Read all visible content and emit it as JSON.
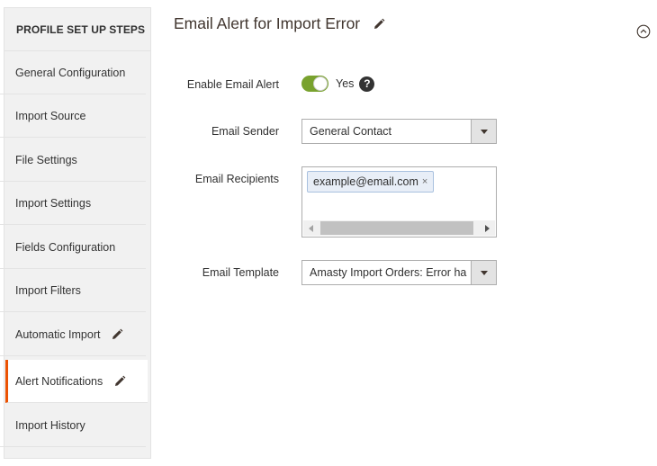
{
  "sidebar": {
    "heading": "PROFILE SET UP STEPS",
    "items": [
      {
        "label": "General Configuration"
      },
      {
        "label": "Import Source"
      },
      {
        "label": "File Settings"
      },
      {
        "label": "Import Settings"
      },
      {
        "label": "Fields Configuration"
      },
      {
        "label": "Import Filters"
      },
      {
        "label": "Automatic Import"
      },
      {
        "label": "Alert Notifications"
      },
      {
        "label": "Import History"
      }
    ],
    "active_item": "Alert Notifications",
    "accent_color": "#eb5202"
  },
  "main": {
    "title": "Email Alert for Import Error",
    "enable_alert": {
      "label": "Enable Email Alert",
      "state": "Yes",
      "help_glyph": "?",
      "on_color": "#79a22e"
    },
    "email_sender": {
      "label": "Email Sender",
      "value": "General Contact"
    },
    "email_recipients": {
      "label": "Email Recipients",
      "tags": [
        "example@email.com"
      ],
      "remove_glyph": "×"
    },
    "email_template": {
      "label": "Email Template",
      "value": "Amasty Import Orders: Error ha"
    }
  },
  "icons": {
    "edit": "pencil-icon",
    "collapse": "chevron-up-circle-icon"
  }
}
